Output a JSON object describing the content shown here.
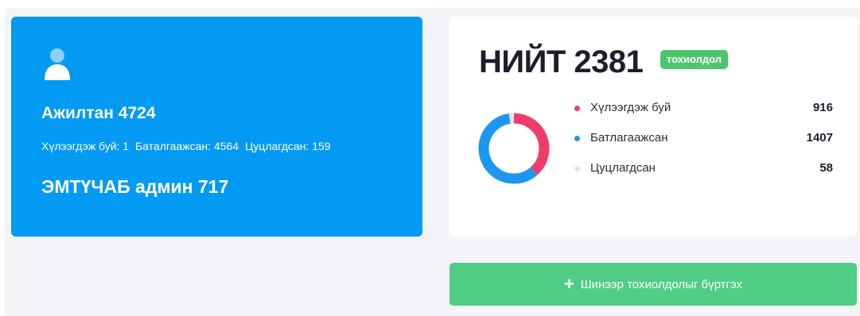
{
  "employees": {
    "title": "Ажилтан 4724",
    "pending": "Хүлээгдэж буй: 1",
    "confirmed": "Баталгаажсан: 4564",
    "cancelled": "Цуцлагдсан: 159",
    "admin": "ЭМТҮЧАБ админ 717",
    "icon": "user-icon"
  },
  "stats": {
    "title": "НИЙТ 2381",
    "badge": "тохиолдол",
    "items": [
      {
        "label": "Хүлээгдэж буй",
        "value": 916,
        "color": "#ef3d6a"
      },
      {
        "label": "Батлагаажсан",
        "value": 1407,
        "color": "#1d96f0"
      },
      {
        "label": "Цуцлагдсан",
        "value": 58,
        "color": "#e2e4ec"
      }
    ]
  },
  "add_button": {
    "label": "Шинээр тохиолдолыг бүртгэх",
    "icon": "plus-icon"
  },
  "colors": {
    "card_blue": "#039af3",
    "badge_green": "#4cc56c",
    "button_green": "#4fcd85",
    "background": "#f3f5f9"
  }
}
